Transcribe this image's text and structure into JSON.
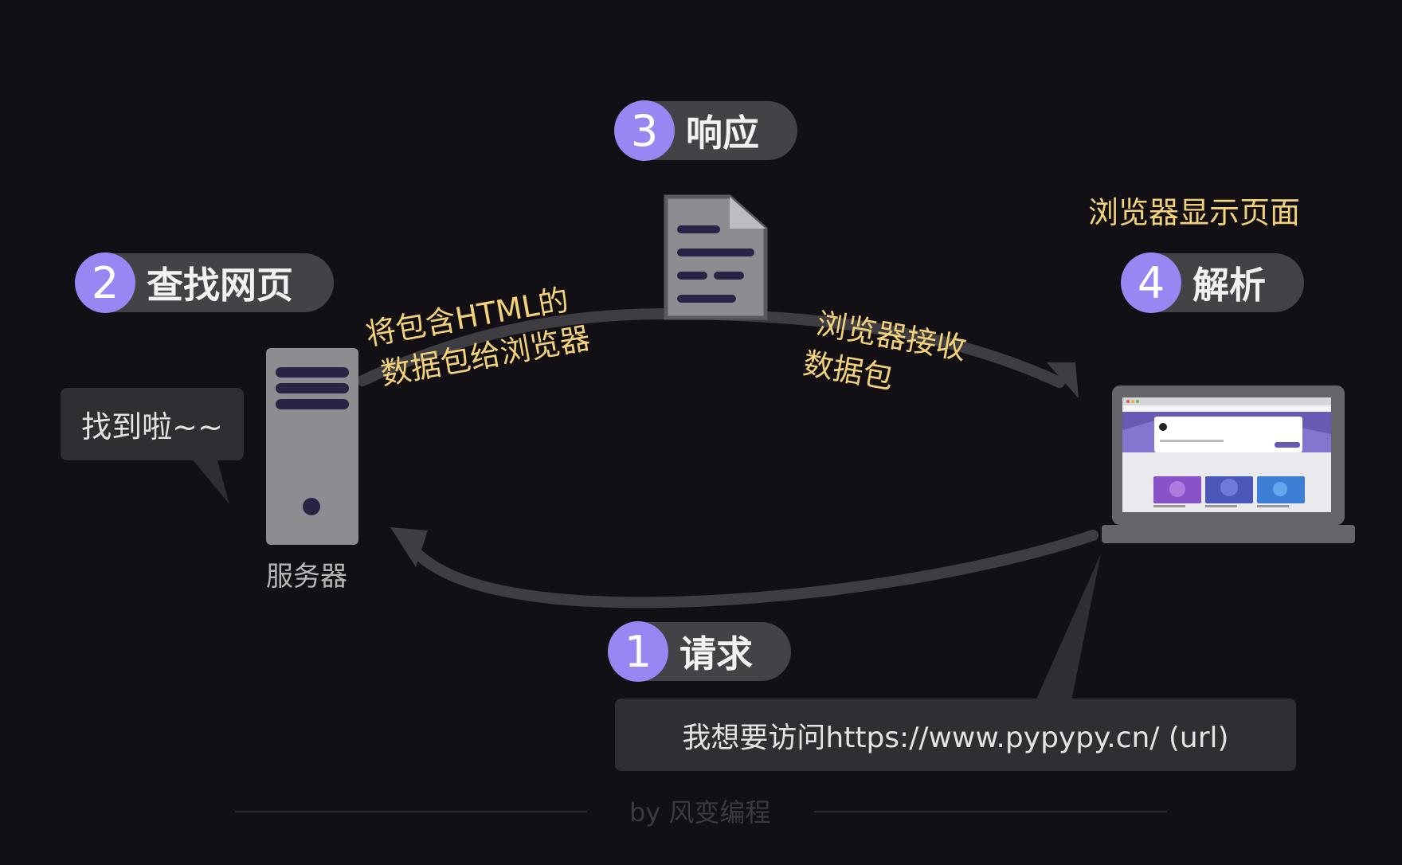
{
  "steps": [
    {
      "num": "1",
      "label": "请求"
    },
    {
      "num": "2",
      "label": "查找网页"
    },
    {
      "num": "3",
      "label": "响应"
    },
    {
      "num": "4",
      "label": "解析"
    }
  ],
  "server_label": "服务器",
  "found_bubble": "找到啦~~",
  "send_line1": "将包含HTML的",
  "send_line2": "数据包给浏览器",
  "receive_line1": "浏览器接收",
  "receive_line2": "数据包",
  "display_label": "浏览器显示页面",
  "request_bubble": "我想要访问https://www.pypypy.cn/ (url)",
  "footer": "by 风变编程",
  "colors": {
    "accent": "#9a86f2",
    "annotation": "#f4d27a",
    "background": "#121015",
    "pill": "#434246"
  }
}
